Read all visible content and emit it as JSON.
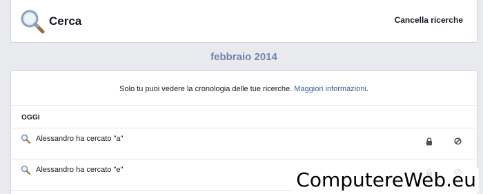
{
  "header": {
    "title": "Cerca",
    "clear_label": "Cancella ricerche"
  },
  "month": "febbraio 2014",
  "privacy": {
    "text": "Solo tu puoi vedere la cronologia delle tue ricerche. ",
    "link": "Maggiori informazioni",
    "suffix": "."
  },
  "section": {
    "label": "OGGI"
  },
  "entries": [
    {
      "text": "Alessandro ha cercato \"a\""
    },
    {
      "text": "Alessandro ha cercato \"e\""
    }
  ],
  "watermark": "ComputereWeb.eu",
  "colors": {
    "background": "#e9eaed",
    "month": "#6d84b4",
    "link": "#3b5998"
  },
  "icons": {
    "header": "magnifier-icon",
    "entry": "magnifier-icon",
    "privacy": "lock-icon",
    "remove": "remove-icon"
  }
}
